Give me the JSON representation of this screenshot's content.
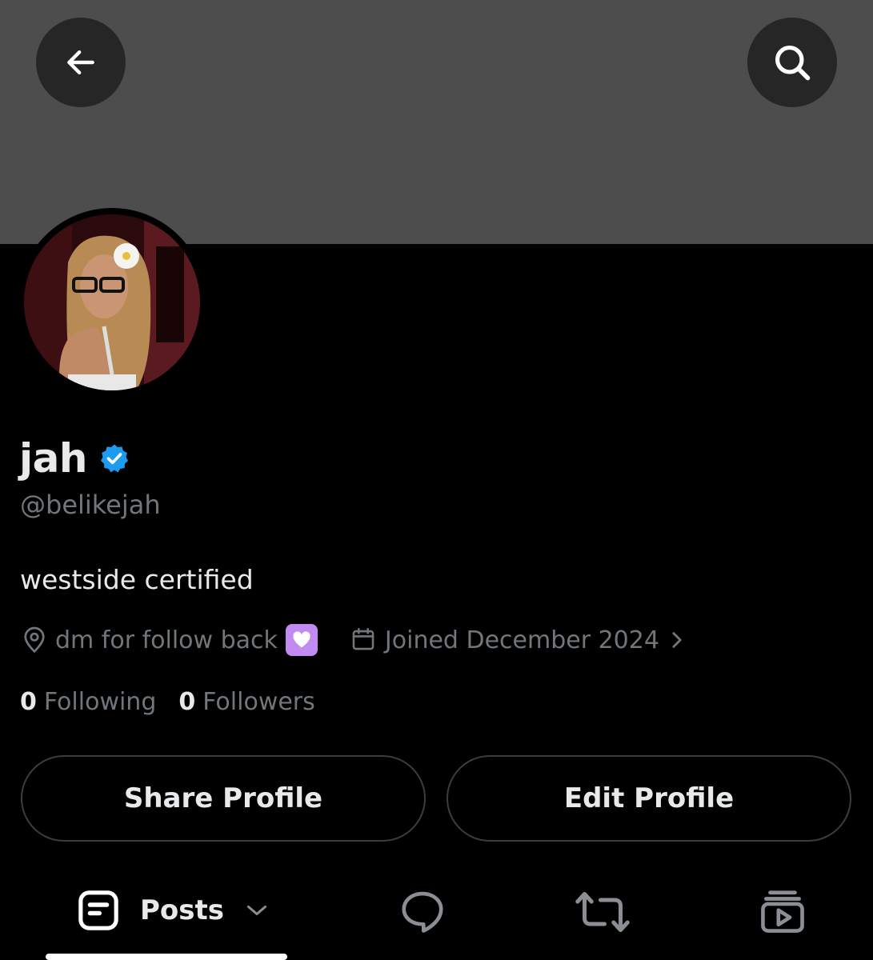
{
  "header": {
    "back_icon": "arrow-left-icon",
    "search_icon": "search-icon"
  },
  "profile": {
    "display_name": "jah",
    "verified_icon": "verified-badge-icon",
    "verified_color": "#1d9bf0",
    "handle": "@belikejah",
    "bio": "westside certified",
    "location": "dm for follow back",
    "location_emoji": "purple-heart-emoji",
    "joined": "Joined December 2024",
    "following_count": "0",
    "following_label": "Following",
    "followers_count": "0",
    "followers_label": "Followers"
  },
  "actions": {
    "share_label": "Share Profile",
    "edit_label": "Edit Profile"
  },
  "tabs": [
    {
      "label": "Posts",
      "icon": "posts-icon",
      "selected": true
    },
    {
      "label": "",
      "icon": "replies-icon",
      "selected": false
    },
    {
      "label": "",
      "icon": "repost-icon",
      "selected": false
    },
    {
      "label": "",
      "icon": "media-icon",
      "selected": false
    }
  ],
  "colors": {
    "background": "#000000",
    "banner": "#4d4d4d",
    "primary_text": "#e7e9ea",
    "secondary_text": "#71767b",
    "border": "#3a3d41"
  }
}
